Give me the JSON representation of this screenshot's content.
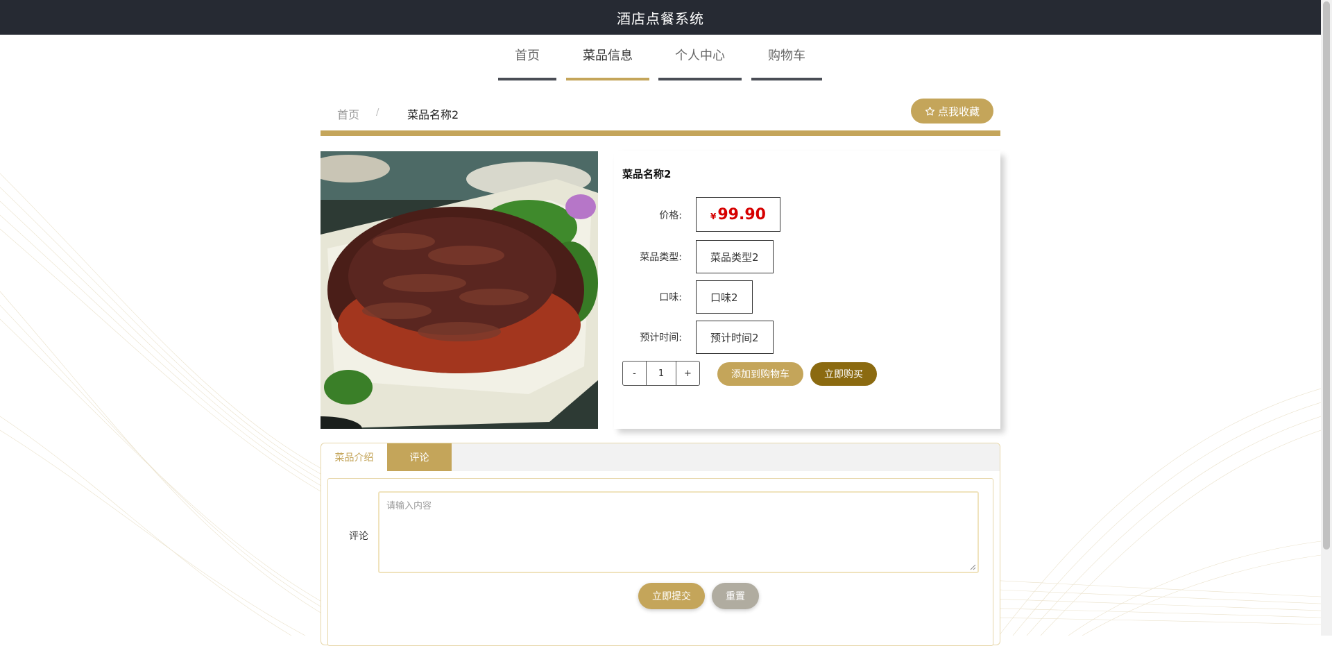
{
  "app": {
    "title": "酒店点餐系统"
  },
  "nav": {
    "items": [
      {
        "label": "首页"
      },
      {
        "label": "菜品信息"
      },
      {
        "label": "个人中心"
      },
      {
        "label": "购物车"
      }
    ],
    "active": "菜品信息"
  },
  "breadcrumb": {
    "home": "首页",
    "separator": "/",
    "current": "菜品名称2"
  },
  "favorite": {
    "label": "点我收藏",
    "icon": "star-outline-icon"
  },
  "dish": {
    "name": "菜品名称2",
    "price_label": "价格:",
    "currency": "¥",
    "price": "99.90",
    "type_label": "菜品类型:",
    "type": "菜品类型2",
    "flavor_label": "口味:",
    "flavor": "口味2",
    "time_label": "预计时间:",
    "time": "预计时间2"
  },
  "quantity": {
    "minus": "-",
    "value": "1",
    "plus": "+"
  },
  "actions": {
    "add_to_cart": "添加到购物车",
    "buy_now": "立即购买"
  },
  "tabs": [
    {
      "label": "菜品介绍"
    },
    {
      "label": "评论"
    }
  ],
  "comment": {
    "label": "评论",
    "placeholder": "请输入内容",
    "submit": "立即提交",
    "reset": "重置"
  },
  "colors": {
    "topbar": "#262a33",
    "accent": "#c4a55a",
    "buy": "#8b6a10",
    "price": "#d60000",
    "reset": "#b0aca0"
  }
}
